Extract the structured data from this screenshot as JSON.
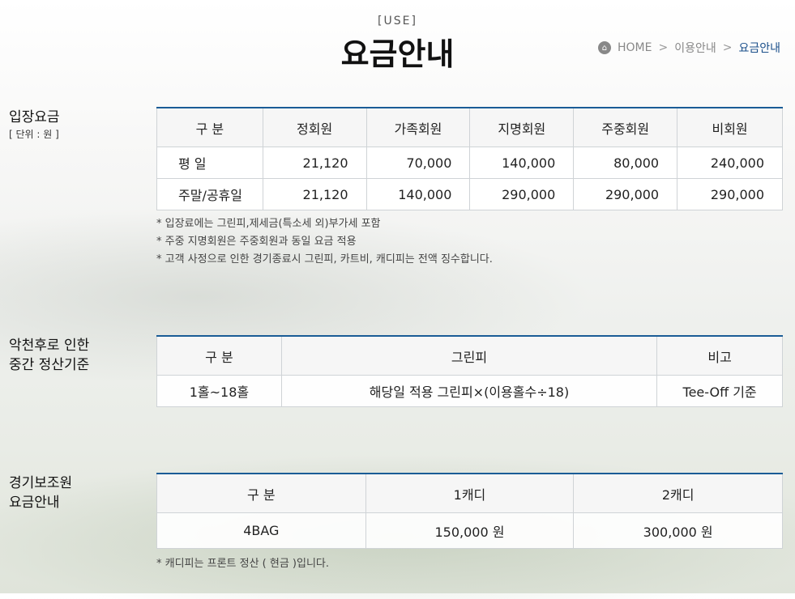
{
  "header": {
    "section_label": "[USE]",
    "title": "요금안내",
    "breadcrumb": [
      "HOME",
      "이용안내",
      "요금안내"
    ],
    "breadcrumb_sep": ">"
  },
  "admission": {
    "title": "입장요금",
    "unit": "[ 단위 : 원 ]",
    "headers": [
      "구 분",
      "정회원",
      "가족회원",
      "지명회원",
      "주중회원",
      "비회원"
    ],
    "rows": [
      [
        "평 일",
        "21,120",
        "70,000",
        "140,000",
        "80,000",
        "240,000"
      ],
      [
        "주말/공휴일",
        "21,120",
        "140,000",
        "290,000",
        "290,000",
        "290,000"
      ]
    ],
    "notes": [
      "* 입장료에는 그린피,제세금(특소세 외)부가세 포함",
      "* 주중 지명회원은 주중회원과 동일 요금 적용",
      "* 고객 사정으로 인한 경기종료시 그린피, 카트비, 캐디피는 전액 징수합니다."
    ]
  },
  "weather": {
    "title_line1": "악천후로 인한",
    "title_line2": "중간 정산기준",
    "headers": [
      "구 분",
      "그린피",
      "비고"
    ],
    "rows": [
      [
        "1홀~18홀",
        "해당일 적용 그린피×(이용홀수÷18)",
        "Tee-Off 기준"
      ]
    ]
  },
  "caddie": {
    "title_line1": "경기보조원",
    "title_line2": "요금안내",
    "headers": [
      "구 분",
      "1캐디",
      "2캐디"
    ],
    "rows": [
      [
        "4BAG",
        "150,000 원",
        "300,000 원"
      ]
    ],
    "note": "* 캐디피는 프론트 정산 ( 현금 )입니다."
  },
  "colors": {
    "accent": "#1a5c96",
    "breadcrumb_active": "#1a4f8a"
  },
  "icons": {
    "home": "home-icon"
  }
}
